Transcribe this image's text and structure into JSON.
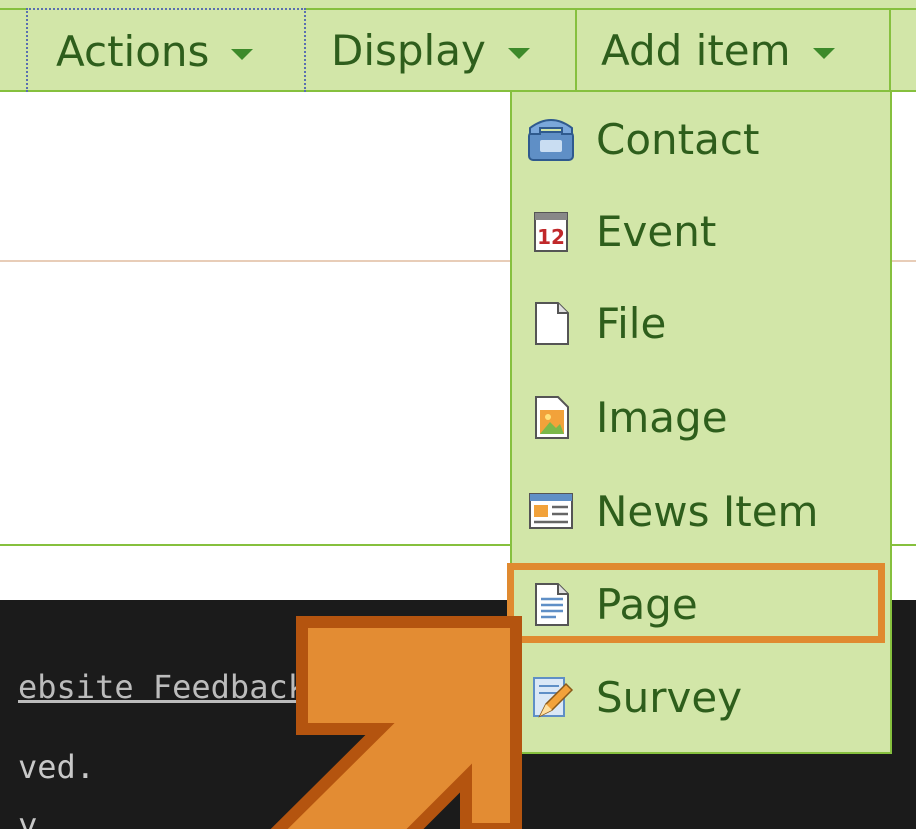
{
  "menubar": {
    "tabs": [
      {
        "label": "Actions"
      },
      {
        "label": "Display"
      },
      {
        "label": "Add item"
      }
    ]
  },
  "dropdown": {
    "items": [
      {
        "label": "Contact",
        "icon": "contact-phone-icon"
      },
      {
        "label": "Event",
        "icon": "calendar-event-icon"
      },
      {
        "label": "File",
        "icon": "file-icon"
      },
      {
        "label": "Image",
        "icon": "image-icon"
      },
      {
        "label": "News Item",
        "icon": "news-item-icon"
      },
      {
        "label": "Page",
        "icon": "page-icon"
      },
      {
        "label": "Survey",
        "icon": "survey-icon"
      }
    ],
    "highlighted_item": "Page"
  },
  "footer": {
    "link_text": "ebsite Feedback?",
    "line1": "ved.",
    "line2": "y"
  },
  "colors": {
    "menu_bg": "#d2e6a8",
    "menu_border": "#86c03e",
    "menu_text": "#2e5e1c",
    "highlight": "#e08a30",
    "footer_bg": "#1b1b1b"
  }
}
